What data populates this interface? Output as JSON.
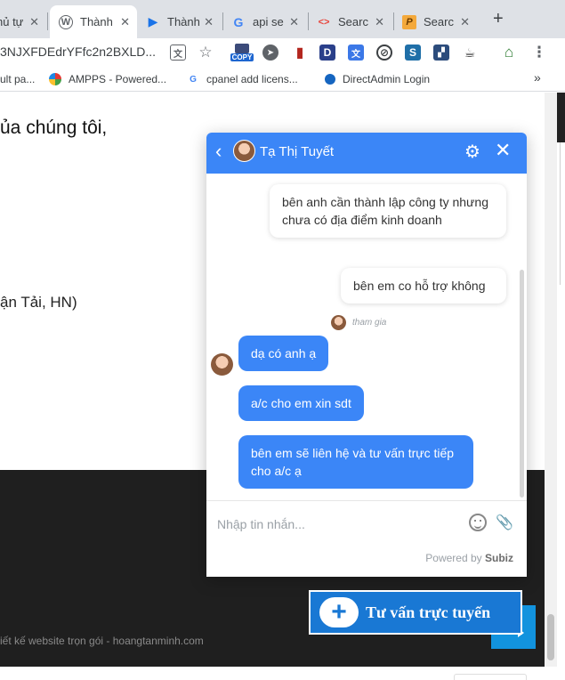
{
  "browser": {
    "tabs": [
      {
        "title": "hủ tự",
        "icon": "generic-page-icon"
      },
      {
        "title": "Thành",
        "icon": "wordpress-icon",
        "active": true
      },
      {
        "title": "Thành",
        "icon": "arrow-play-icon"
      },
      {
        "title": "api se",
        "icon": "google-icon"
      },
      {
        "title": "Searc",
        "icon": "code-icon"
      },
      {
        "title": "Searc",
        "icon": "p-logo-icon"
      }
    ],
    "new_tab": "+",
    "url": "3NJXFDEdrYFfc2n2BXLD...",
    "extensions": {
      "copy_label": "COPY",
      "d_label": "D"
    },
    "bookmarks": [
      {
        "label": "ult pa...",
        "icon": ""
      },
      {
        "label": "AMPPS - Powered...",
        "icon": "ampps-icon"
      },
      {
        "label": "cpanel add licens...",
        "icon": "google-icon"
      },
      {
        "label": "DirectAdmin Login",
        "icon": "directadmin-icon"
      }
    ],
    "bookmarks_more": "»"
  },
  "page": {
    "text1": "ủa chúng tôi,",
    "text2": "ận Tải, HN)",
    "footer": "iết kế website trọn gói - hoangtanminh.com"
  },
  "chat": {
    "agent_name": "Tạ Thị Tuyết",
    "messages": {
      "m1": "bên anh cần thành lập công ty nhưng chưa có địa điểm kinh doanh",
      "m2": "bên em co hỗ trợ không",
      "join": "tham gia",
      "m3": "dạ có anh ạ",
      "m4": "a/c cho em xin sdt",
      "m5": "bên em sẽ liên hệ và tư vấn trực tiếp cho a/c ạ"
    },
    "input_placeholder": "Nhập tin nhắn...",
    "powered_prefix": "Powered by",
    "powered_brand": "Subiz"
  },
  "consult_button": {
    "label": "Tư vấn trực tuyến"
  },
  "colors": {
    "chat_blue": "#3b86f7",
    "consult_blue": "#1978d4",
    "dark_footer": "#1f1f1f"
  }
}
